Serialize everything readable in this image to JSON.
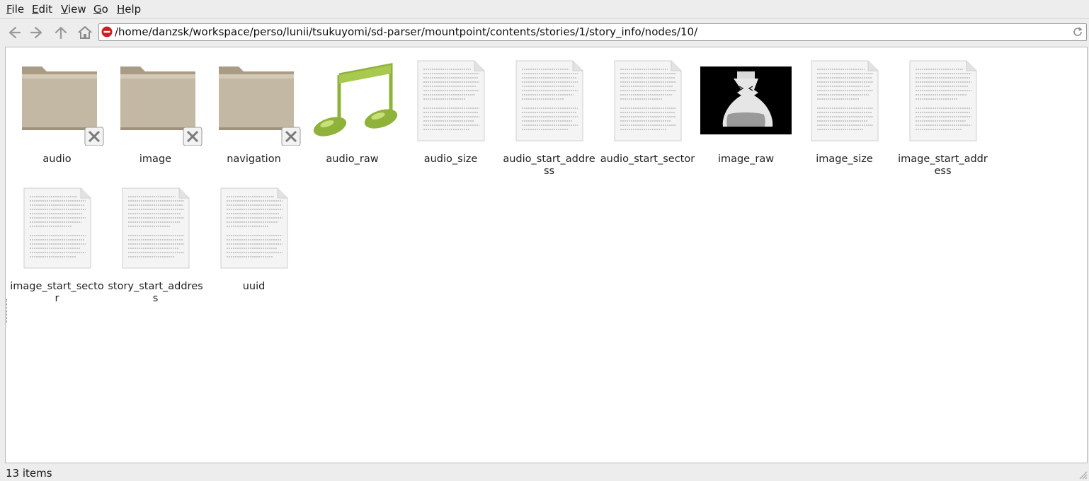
{
  "menu": {
    "items": [
      {
        "key": "F",
        "rest": "ile"
      },
      {
        "key": "E",
        "rest": "dit"
      },
      {
        "key": "V",
        "rest": "iew"
      },
      {
        "key": "G",
        "rest": "o"
      },
      {
        "key": "H",
        "rest": "elp"
      }
    ]
  },
  "toolbar": {
    "back_icon": "back-arrow-icon",
    "forward_icon": "forward-arrow-icon",
    "up_icon": "up-arrow-icon",
    "home_icon": "home-icon"
  },
  "location": {
    "path": "/home/danzsk/workspace/perso/lunii/tsukuyomi/sd-parser/mountpoint/contents/stories/1/story_info/nodes/10/",
    "status_icon": "stop-icon",
    "reload_icon": "reload-icon"
  },
  "files": [
    {
      "name": "audio",
      "type": "folder",
      "emblem": "unreadable"
    },
    {
      "name": "image",
      "type": "folder",
      "emblem": "unreadable"
    },
    {
      "name": "navigation",
      "type": "folder",
      "emblem": "unreadable"
    },
    {
      "name": "audio_raw",
      "type": "audio"
    },
    {
      "name": "audio_size",
      "type": "text"
    },
    {
      "name": "audio_start_address",
      "type": "text"
    },
    {
      "name": "audio_start_sector",
      "type": "text"
    },
    {
      "name": "image_raw",
      "type": "image"
    },
    {
      "name": "image_size",
      "type": "text"
    },
    {
      "name": "image_start_address",
      "type": "text"
    },
    {
      "name": "image_start_sector",
      "type": "text"
    },
    {
      "name": "story_start_address",
      "type": "text"
    },
    {
      "name": "uuid",
      "type": "text"
    }
  ],
  "status": {
    "text": "13 items"
  },
  "colors": {
    "folder": "#b9ad98",
    "audio_note": "#8fb33a",
    "stop": "#cc1f1f"
  }
}
